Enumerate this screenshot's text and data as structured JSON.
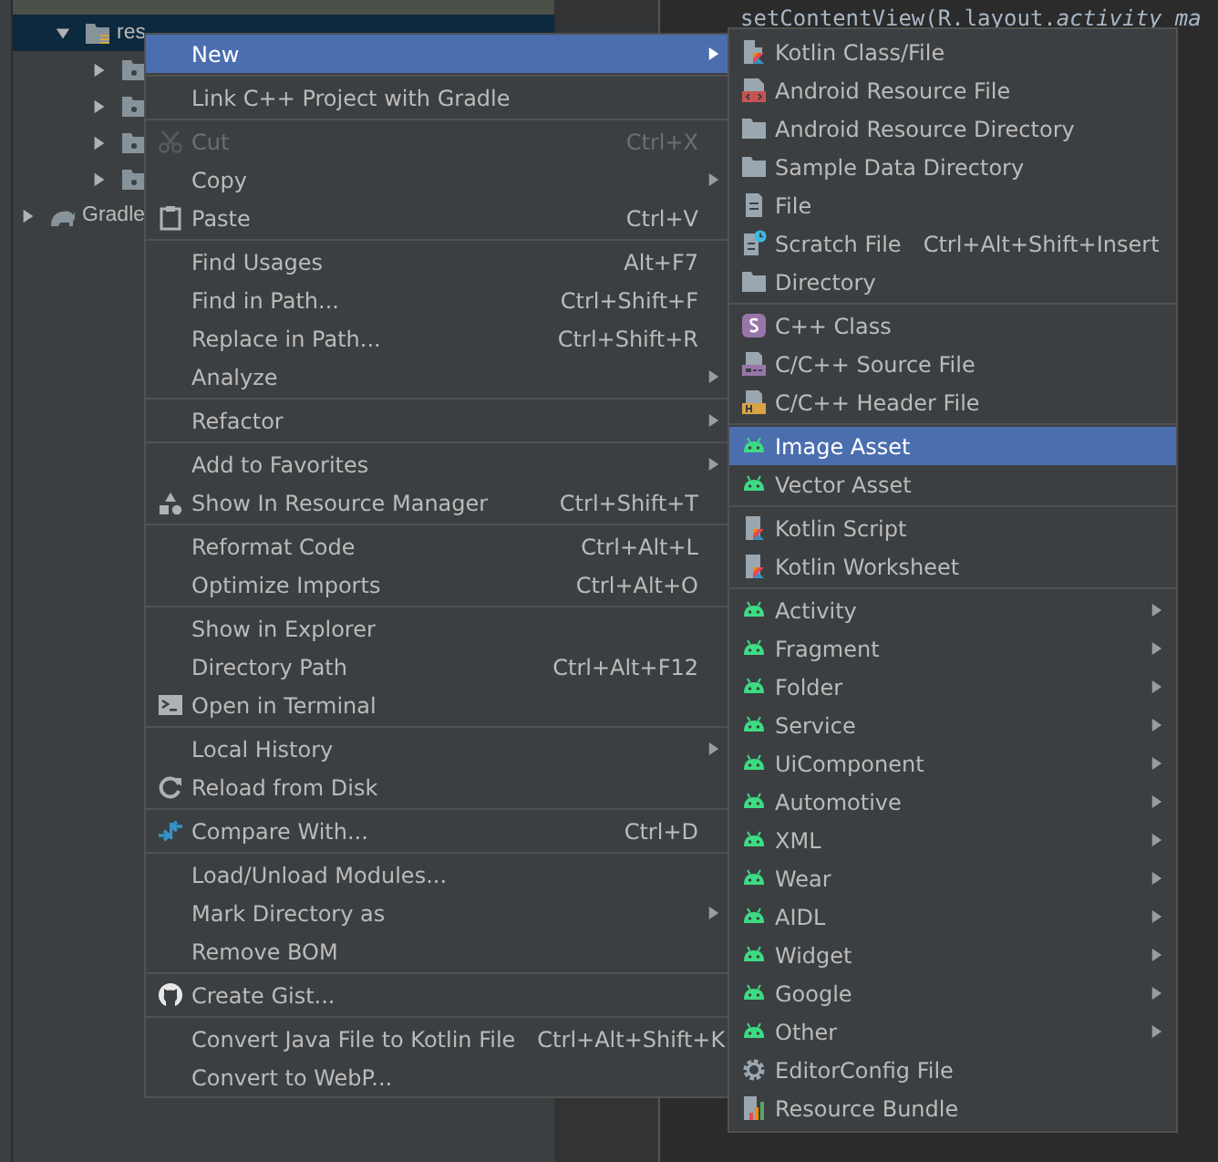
{
  "project_tree": {
    "items": [
      {
        "kind": "res-folder",
        "label": "res",
        "expanded": true,
        "selected": true,
        "children": [
          {
            "kind": "folder",
            "expanded": false,
            "selected": false
          },
          {
            "kind": "folder",
            "expanded": false,
            "selected": false
          },
          {
            "kind": "folder",
            "expanded": false,
            "selected": false
          },
          {
            "kind": "folder",
            "expanded": false,
            "selected": false
          }
        ]
      },
      {
        "kind": "gradle",
        "label": "Gradle",
        "expanded": false,
        "selected": false
      }
    ]
  },
  "editor": {
    "code_lines": [
      "setContentView(R.layout.*activity_ma*"
    ]
  },
  "context_menu": {
    "groups": [
      {
        "items": [
          {
            "label": "New",
            "has_submenu": true,
            "selected": true,
            "disabled": false
          }
        ]
      },
      {
        "items": [
          {
            "label": "Link C++ Project with Gradle",
            "has_submenu": false,
            "selected": false,
            "disabled": false
          }
        ]
      },
      {
        "items": [
          {
            "label": "Cut",
            "shortcut": "Ctrl+X",
            "kind": "scissors",
            "has_submenu": false,
            "selected": false,
            "disabled": true
          },
          {
            "label": "Copy",
            "has_submenu": true,
            "selected": false,
            "disabled": false
          },
          {
            "label": "Paste",
            "shortcut": "Ctrl+V",
            "kind": "clipboard",
            "has_submenu": false,
            "selected": false,
            "disabled": false
          }
        ]
      },
      {
        "items": [
          {
            "label": "Find Usages",
            "shortcut": "Alt+F7",
            "has_submenu": false,
            "selected": false,
            "disabled": false
          },
          {
            "label": "Find in Path...",
            "shortcut": "Ctrl+Shift+F",
            "has_submenu": false,
            "selected": false,
            "disabled": false
          },
          {
            "label": "Replace in Path...",
            "shortcut": "Ctrl+Shift+R",
            "has_submenu": false,
            "selected": false,
            "disabled": false
          },
          {
            "label": "Analyze",
            "has_submenu": true,
            "selected": false,
            "disabled": false
          }
        ]
      },
      {
        "items": [
          {
            "label": "Refactor",
            "has_submenu": true,
            "selected": false,
            "disabled": false
          }
        ]
      },
      {
        "items": [
          {
            "label": "Add to Favorites",
            "has_submenu": true,
            "selected": false,
            "disabled": false
          },
          {
            "label": "Show In Resource Manager",
            "shortcut": "Ctrl+Shift+T",
            "kind": "shapes",
            "has_submenu": false,
            "selected": false,
            "disabled": false
          }
        ]
      },
      {
        "items": [
          {
            "label": "Reformat Code",
            "shortcut": "Ctrl+Alt+L",
            "has_submenu": false,
            "selected": false,
            "disabled": false
          },
          {
            "label": "Optimize Imports",
            "shortcut": "Ctrl+Alt+O",
            "has_submenu": false,
            "selected": false,
            "disabled": false
          }
        ]
      },
      {
        "items": [
          {
            "label": "Show in Explorer",
            "has_submenu": false,
            "selected": false,
            "disabled": false
          },
          {
            "label": "Directory Path",
            "shortcut": "Ctrl+Alt+F12",
            "has_submenu": false,
            "selected": false,
            "disabled": false
          },
          {
            "label": "Open in Terminal",
            "kind": "terminal",
            "has_submenu": false,
            "selected": false,
            "disabled": false
          }
        ]
      },
      {
        "items": [
          {
            "label": "Local History",
            "has_submenu": true,
            "selected": false,
            "disabled": false
          },
          {
            "label": "Reload from Disk",
            "kind": "reload",
            "has_submenu": false,
            "selected": false,
            "disabled": false
          }
        ]
      },
      {
        "items": [
          {
            "label": "Compare With...",
            "shortcut": "Ctrl+D",
            "kind": "compare",
            "has_submenu": false,
            "selected": false,
            "disabled": false
          }
        ]
      },
      {
        "items": [
          {
            "label": "Load/Unload Modules...",
            "has_submenu": false,
            "selected": false,
            "disabled": false
          },
          {
            "label": "Mark Directory as",
            "has_submenu": true,
            "selected": false,
            "disabled": false
          },
          {
            "label": "Remove BOM",
            "has_submenu": false,
            "selected": false,
            "disabled": false
          }
        ]
      },
      {
        "items": [
          {
            "label": "Create Gist...",
            "kind": "octo",
            "has_submenu": false,
            "selected": false,
            "disabled": false
          }
        ]
      },
      {
        "items": [
          {
            "label": "Convert Java File to Kotlin File",
            "shortcut": "Ctrl+Alt+Shift+K",
            "has_submenu": false,
            "selected": false,
            "disabled": false
          },
          {
            "label": "Convert to WebP...",
            "has_submenu": false,
            "selected": false,
            "disabled": false
          }
        ]
      }
    ]
  },
  "new_submenu": {
    "groups": [
      {
        "items": [
          {
            "label": "Kotlin Class/File",
            "kind": "kotlin",
            "has_submenu": false,
            "selected": false
          },
          {
            "label": "Android Resource File",
            "kind": "resfile",
            "has_submenu": false,
            "selected": false
          },
          {
            "label": "Android Resource Directory",
            "kind": "folder",
            "has_submenu": false,
            "selected": false
          },
          {
            "label": "Sample Data Directory",
            "kind": "folder",
            "has_submenu": false,
            "selected": false
          },
          {
            "label": "File",
            "kind": "file",
            "has_submenu": false,
            "selected": false
          },
          {
            "label": "Scratch File",
            "shortcut": "Ctrl+Alt+Shift+Insert",
            "kind": "scratch",
            "has_submenu": false,
            "selected": false
          },
          {
            "label": "Directory",
            "kind": "folder",
            "has_submenu": false,
            "selected": false
          }
        ]
      },
      {
        "items": [
          {
            "label": "C++ Class",
            "kind": "cppclass",
            "has_submenu": false,
            "selected": false
          },
          {
            "label": "C/C++ Source File",
            "kind": "source",
            "has_submenu": false,
            "selected": false
          },
          {
            "label": "C/C++ Header File",
            "kind": "header",
            "has_submenu": false,
            "selected": false
          }
        ]
      },
      {
        "items": [
          {
            "label": "Image Asset",
            "kind": "android",
            "has_submenu": false,
            "selected": true
          },
          {
            "label": "Vector Asset",
            "kind": "android",
            "has_submenu": false,
            "selected": false
          }
        ]
      },
      {
        "items": [
          {
            "label": "Kotlin Script",
            "kind": "kscript",
            "has_submenu": false,
            "selected": false
          },
          {
            "label": "Kotlin Worksheet",
            "kind": "kscript",
            "has_submenu": false,
            "selected": false
          }
        ]
      },
      {
        "items": [
          {
            "label": "Activity",
            "kind": "android",
            "has_submenu": true,
            "selected": false
          },
          {
            "label": "Fragment",
            "kind": "android",
            "has_submenu": true,
            "selected": false
          },
          {
            "label": "Folder",
            "kind": "android",
            "has_submenu": true,
            "selected": false
          },
          {
            "label": "Service",
            "kind": "android",
            "has_submenu": true,
            "selected": false
          },
          {
            "label": "UiComponent",
            "kind": "android",
            "has_submenu": true,
            "selected": false
          },
          {
            "label": "Automotive",
            "kind": "android",
            "has_submenu": true,
            "selected": false
          },
          {
            "label": "XML",
            "kind": "android",
            "has_submenu": true,
            "selected": false
          },
          {
            "label": "Wear",
            "kind": "android",
            "has_submenu": true,
            "selected": false
          },
          {
            "label": "AIDL",
            "kind": "android",
            "has_submenu": true,
            "selected": false
          },
          {
            "label": "Widget",
            "kind": "android",
            "has_submenu": true,
            "selected": false
          },
          {
            "label": "Google",
            "kind": "android",
            "has_submenu": true,
            "selected": false
          },
          {
            "label": "Other",
            "kind": "android",
            "has_submenu": true,
            "selected": false
          },
          {
            "label": "EditorConfig File",
            "kind": "gear",
            "has_submenu": false,
            "selected": false
          },
          {
            "label": "Resource Bundle",
            "kind": "bundle",
            "has_submenu": false,
            "selected": false
          }
        ]
      }
    ]
  }
}
